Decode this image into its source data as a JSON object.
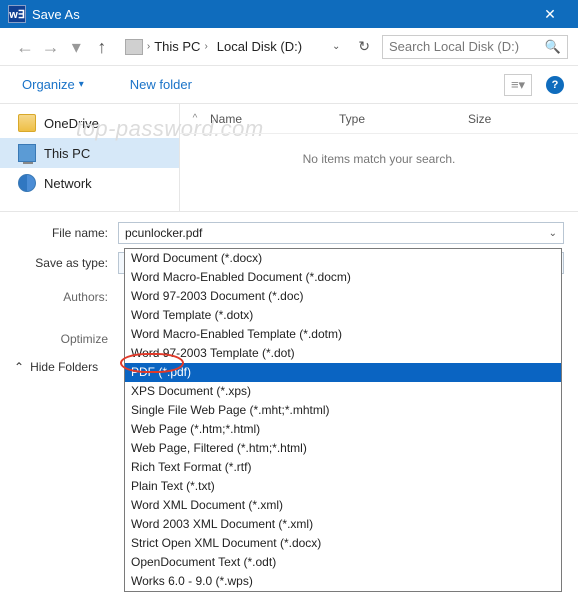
{
  "title_bar": {
    "app_initials": "w∃",
    "title": "Save As",
    "close_glyph": "✕"
  },
  "nav": {
    "back": "←",
    "forward": "→",
    "recent": "▾",
    "up": "↑",
    "bc_first_sep": "›",
    "bc1": "This PC",
    "bc1_sep": "›",
    "bc2": "Local Disk (D:)",
    "combo_chev": "⌄",
    "refresh": "↻"
  },
  "search": {
    "placeholder": "Search Local Disk (D:)",
    "icon": "🔍"
  },
  "toolbar": {
    "organize": "Organize",
    "organize_chev": "▾",
    "newfolder": "New folder",
    "view_glyph": "≡▾",
    "help": "?"
  },
  "sidebar": {
    "items": [
      {
        "label": "OneDrive"
      },
      {
        "label": "This PC"
      },
      {
        "label": "Network"
      }
    ]
  },
  "list": {
    "col_name": "Name",
    "col_type": "Type",
    "col_size": "Size",
    "empty": "No items match your search.",
    "chev": "^"
  },
  "form": {
    "filename_label": "File name:",
    "filename_value": "pcunlocker.pdf",
    "type_label": "Save as type:",
    "type_value": "PDF (*.pdf)",
    "authors_label": "Authors:",
    "optimize_label": "Optimize"
  },
  "dropdown": {
    "options": [
      "Word Document (*.docx)",
      "Word Macro-Enabled Document (*.docm)",
      "Word 97-2003 Document (*.doc)",
      "Word Template (*.dotx)",
      "Word Macro-Enabled Template (*.dotm)",
      "Word 97-2003 Template (*.dot)",
      "PDF (*.pdf)",
      "XPS Document (*.xps)",
      "Single File Web Page (*.mht;*.mhtml)",
      "Web Page (*.htm;*.html)",
      "Web Page, Filtered (*.htm;*.html)",
      "Rich Text Format (*.rtf)",
      "Plain Text (*.txt)",
      "Word XML Document (*.xml)",
      "Word 2003 XML Document (*.xml)",
      "Strict Open XML Document (*.docx)",
      "OpenDocument Text (*.odt)",
      "Works 6.0 - 9.0 (*.wps)"
    ],
    "selected_index": 6
  },
  "footer": {
    "hide_folders": "Hide Folders",
    "chev": "⌃"
  },
  "watermark": "top-password.com"
}
